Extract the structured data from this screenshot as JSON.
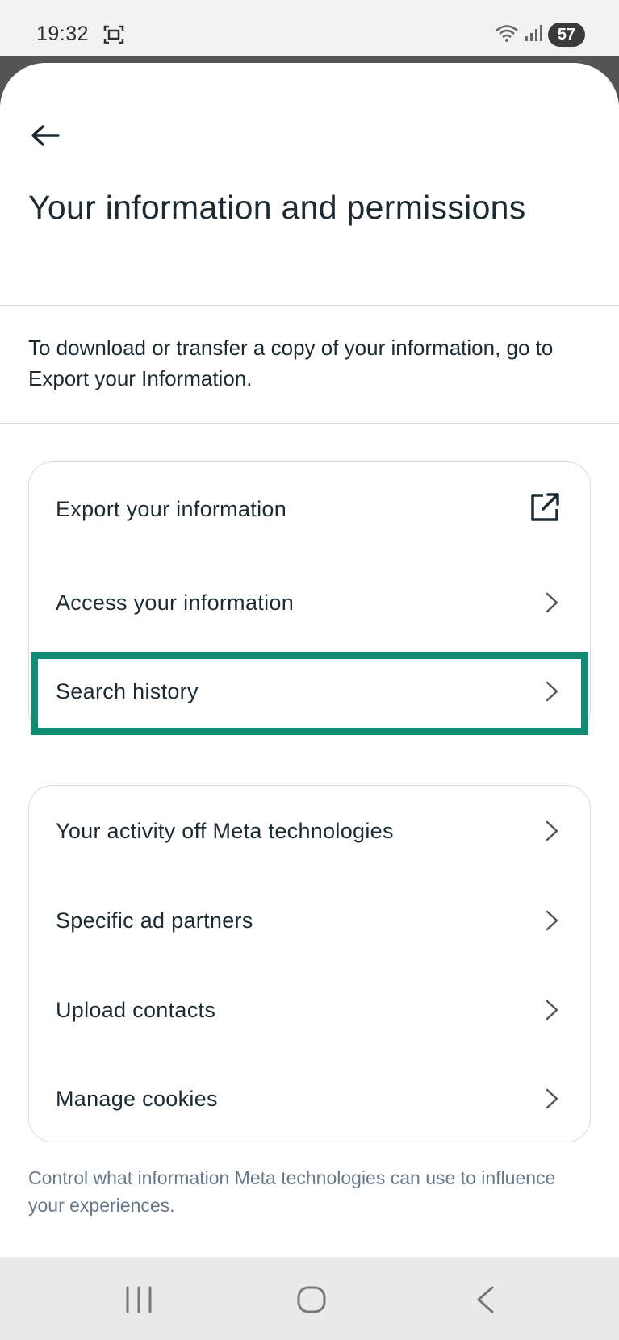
{
  "status_bar": {
    "time": "19:32",
    "battery": "57"
  },
  "header": {
    "title": "Your information and permissions"
  },
  "intro": {
    "text": "To download or transfer a copy of your information, go to Export your Information."
  },
  "card_1": {
    "items": [
      {
        "label": "Export your information",
        "icon": "external-link-icon"
      },
      {
        "label": "Access your information",
        "icon": "chevron-right-icon"
      },
      {
        "label": "Search history",
        "icon": "chevron-right-icon"
      }
    ]
  },
  "card_2": {
    "items": [
      {
        "label": "Your activity off Meta technologies",
        "icon": "chevron-right-icon"
      },
      {
        "label": "Specific ad partners",
        "icon": "chevron-right-icon"
      },
      {
        "label": "Upload contacts",
        "icon": "chevron-right-icon"
      },
      {
        "label": "Manage cookies",
        "icon": "chevron-right-icon"
      }
    ]
  },
  "footer": {
    "text": "Control what information Meta technologies can use to influence your experiences."
  },
  "colors": {
    "highlight": "#138a72",
    "text": "#1c2b33",
    "muted": "#67788a"
  }
}
